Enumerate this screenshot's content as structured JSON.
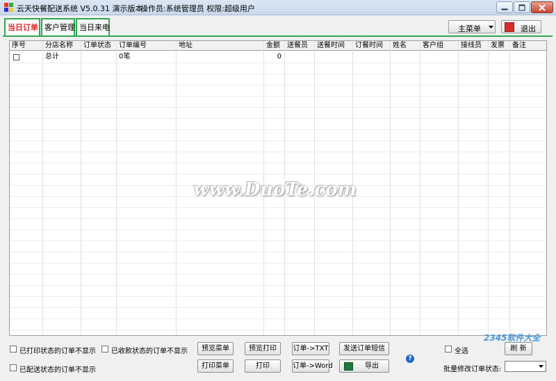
{
  "window": {
    "title": "云天快餐配送系统 V5.0.31 演示版本",
    "operator_info": "操作员:系统管理员  权限:超级用户"
  },
  "tabs": [
    {
      "label": "当日订单"
    },
    {
      "label": "客户管理"
    },
    {
      "label": "当日来电"
    }
  ],
  "toolbar": {
    "main_menu_label": "主菜单",
    "exit_label": "退出"
  },
  "grid": {
    "columns": [
      "序号",
      "分店名称",
      "订单状态",
      "订单编号",
      "地址",
      "金额",
      "送餐员",
      "送餐时间",
      "订餐时间",
      "姓名",
      "客户组",
      "接线员",
      "发票",
      "备注"
    ],
    "rows": [
      {
        "seq": "",
        "branch": "总计",
        "status": "",
        "order_no": "0笔",
        "address": "",
        "amount": "0"
      }
    ]
  },
  "watermark": "www.DuoTe.com",
  "bottom": {
    "chk_printed": "已打印状态的订单不显示",
    "chk_paid": "已收款状态的订单不显示",
    "chk_delivered": "已配送状态的订单不显示",
    "btn_preview_menu": "预览菜单",
    "btn_preview_print": "预览打印",
    "btn_order_txt": "订单->TXT",
    "btn_send_sms": "发送订单短信",
    "btn_print_menu": "打印菜单",
    "btn_print": "打印",
    "btn_order_word": "订单->Word",
    "btn_export": "导出",
    "chk_select_all": "全选",
    "btn_refresh": "刷 新",
    "batch_status_label": "批量修改订单状态:",
    "logo_text": "2345软件大全"
  },
  "colors": {
    "tab_border": "#2fa84f",
    "active_tab_text": "#e02020"
  }
}
